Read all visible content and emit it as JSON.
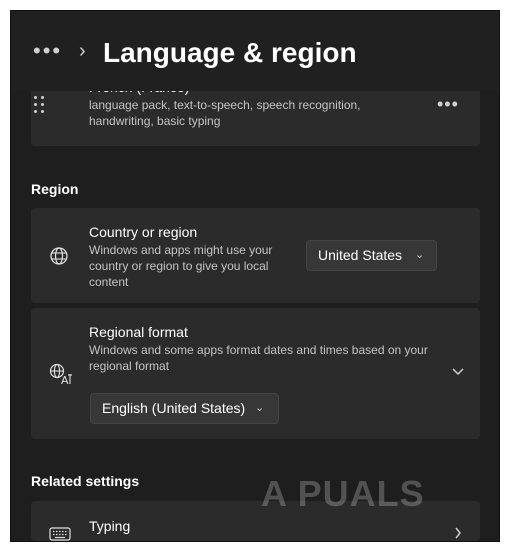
{
  "header": {
    "more_glyph": "•••",
    "breadcrumb_separator": "›",
    "title": "Language & region"
  },
  "language_item": {
    "name": "French (France)",
    "description": "language pack, text-to-speech, speech recognition, handwriting, basic typing",
    "more_glyph": "•••"
  },
  "region_section": {
    "heading": "Region"
  },
  "country_or_region": {
    "icon": "globe-icon",
    "title": "Country or region",
    "description": "Windows and apps might use your country or region to give you local content",
    "selected": "United States"
  },
  "regional_format": {
    "icon": "language-format-icon",
    "title": "Regional format",
    "description": "Windows and some apps format dates and times based on your regional format",
    "selected": "English (United States)"
  },
  "related_settings": {
    "heading": "Related settings"
  },
  "typing": {
    "icon": "keyboard-icon",
    "title": "Typing"
  },
  "watermark": {
    "text": "A  PUALS"
  },
  "colors": {
    "window_bg": "#1e1e1e",
    "card_bg": "#2b2b2b",
    "dropdown_bg": "#373737",
    "text_primary": "#ffffff",
    "text_secondary": "#c5c5c5"
  }
}
